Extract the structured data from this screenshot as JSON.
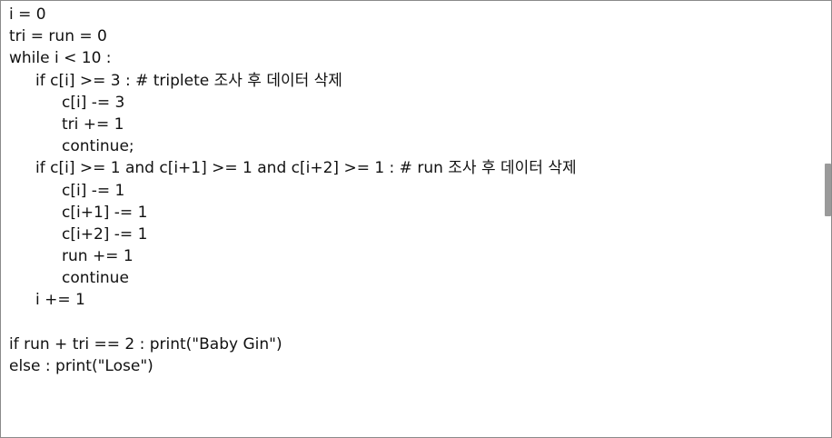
{
  "code_lines": [
    {
      "indent": 0,
      "text": "i = 0"
    },
    {
      "indent": 0,
      "text": "tri = run = 0"
    },
    {
      "indent": 0,
      "text": "while i < 10 :"
    },
    {
      "indent": 1,
      "text": "if c[i] >= 3 : # triplete 조사 후 데이터 삭제"
    },
    {
      "indent": 2,
      "text": "c[i] -= 3"
    },
    {
      "indent": 2,
      "text": "tri += 1"
    },
    {
      "indent": 2,
      "text": "continue;"
    },
    {
      "indent": 1,
      "text": "if c[i] >= 1 and c[i+1] >= 1 and c[i+2] >= 1 : # run 조사 후 데이터 삭제"
    },
    {
      "indent": 2,
      "text": "c[i] -= 1"
    },
    {
      "indent": 2,
      "text": "c[i+1] -= 1"
    },
    {
      "indent": 2,
      "text": "c[i+2] -= 1"
    },
    {
      "indent": 2,
      "text": "run += 1"
    },
    {
      "indent": 2,
      "text": "continue"
    },
    {
      "indent": 1,
      "text": "i += 1"
    },
    {
      "indent": 0,
      "text": ""
    },
    {
      "indent": 0,
      "text": "if run + tri == 2 : print(\"Baby Gin\")"
    },
    {
      "indent": 0,
      "text": "else : print(\"Lose\")"
    }
  ]
}
